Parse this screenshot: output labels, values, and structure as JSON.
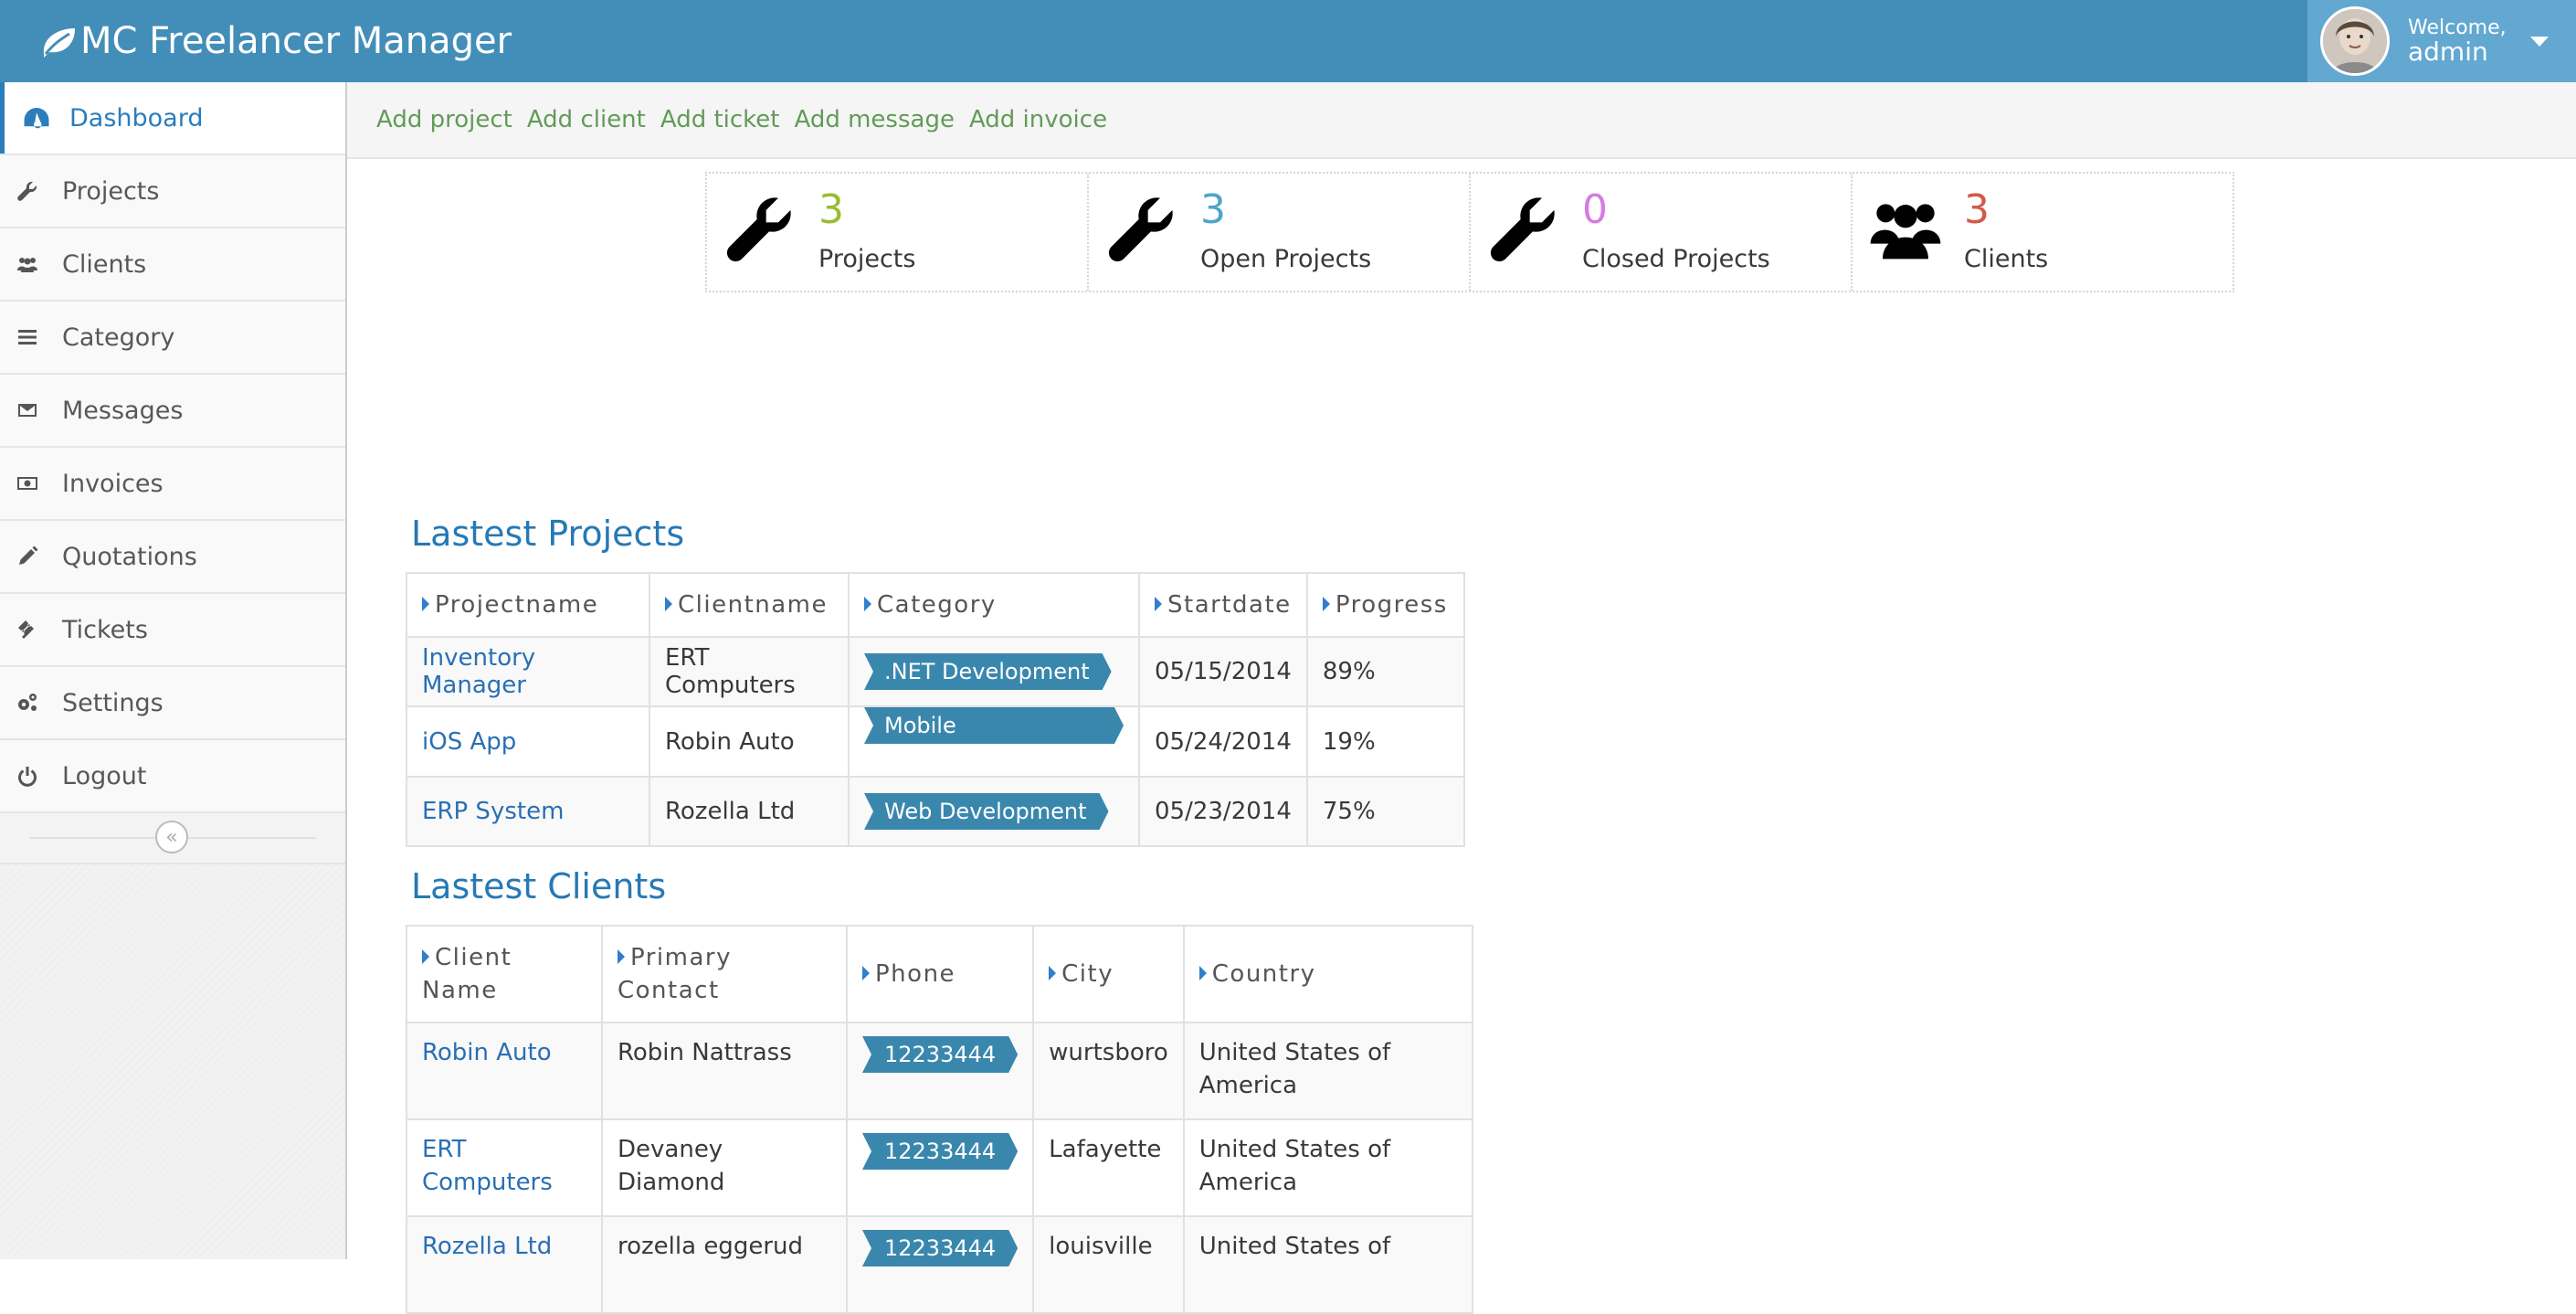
{
  "app": {
    "title": "MC Freelancer Manager"
  },
  "user": {
    "welcome": "Welcome,",
    "name": "admin"
  },
  "sidebar": {
    "items": [
      {
        "label": "Dashboard",
        "icon": "dashboard-icon",
        "active": true
      },
      {
        "label": "Projects",
        "icon": "wrench-icon"
      },
      {
        "label": "Clients",
        "icon": "users-icon"
      },
      {
        "label": "Category",
        "icon": "list-icon"
      },
      {
        "label": "Messages",
        "icon": "envelope-icon"
      },
      {
        "label": "Invoices",
        "icon": "money-icon"
      },
      {
        "label": "Quotations",
        "icon": "pencil-icon"
      },
      {
        "label": "Tickets",
        "icon": "ticket-icon"
      },
      {
        "label": "Settings",
        "icon": "cogs-icon"
      },
      {
        "label": "Logout",
        "icon": "power-icon"
      }
    ],
    "collapse_glyph": "«"
  },
  "quick_links": [
    "Add project",
    "Add client",
    "Add ticket",
    "Add message",
    "Add invoice"
  ],
  "stats": [
    {
      "value": "3",
      "label": "Projects",
      "color": "#9abc32",
      "icon": "wrench-icon"
    },
    {
      "value": "3",
      "label": "Open Projects",
      "color": "#4ea4c9",
      "icon": "wrench-icon"
    },
    {
      "value": "0",
      "label": "Closed Projects",
      "color": "#d67be2",
      "icon": "wrench-icon"
    },
    {
      "value": "3",
      "label": "Clients",
      "color": "#d15b47",
      "icon": "users-icon"
    }
  ],
  "projects": {
    "title": "Lastest Projects",
    "columns": [
      "Projectname",
      "Clientname",
      "Category",
      "Startdate",
      "Progress"
    ],
    "rows": [
      {
        "name": "Inventory Manager",
        "client": "ERT Computers",
        "category": ".NET Development",
        "start": "05/15/2014",
        "progress": "89%"
      },
      {
        "name": "iOS App",
        "client": "Robin Auto",
        "category": "Mobile Development",
        "start": "05/24/2014",
        "progress": "19%"
      },
      {
        "name": "ERP System",
        "client": "Rozella Ltd",
        "category": "Web Development",
        "start": "05/23/2014",
        "progress": "75%"
      }
    ]
  },
  "clients": {
    "title": "Lastest Clients",
    "columns": [
      {
        "line1": "Client",
        "line2": "Name"
      },
      {
        "line1": "Primary",
        "line2": "Contact"
      },
      {
        "line1": "Phone",
        "line2": ""
      },
      {
        "line1": "City",
        "line2": ""
      },
      {
        "line1": "Country",
        "line2": ""
      }
    ],
    "rows": [
      {
        "name_l1": "Robin Auto",
        "name_l2": "",
        "contact": "Robin Nattrass",
        "phone": "12233444",
        "city": "wurtsboro",
        "country_l1": "United States of",
        "country_l2": "America"
      },
      {
        "name_l1": "ERT",
        "name_l2": "Computers",
        "contact": "Devaney Diamond",
        "phone": "12233444",
        "city": "Lafayette",
        "country_l1": "United States of",
        "country_l2": "America"
      },
      {
        "name_l1": "Rozella Ltd",
        "name_l2": "",
        "contact": "rozella eggerud",
        "phone": "12233444",
        "city": "louisville",
        "country_l1": "United States of",
        "country_l2": ""
      }
    ]
  },
  "colors": {
    "navbar": "#438eb9",
    "user_box": "#62a8d1",
    "link": "#2a6fb3",
    "quick_link": "#629b58",
    "ribbon": "#3a87ad",
    "section_title": "#2679b5"
  }
}
